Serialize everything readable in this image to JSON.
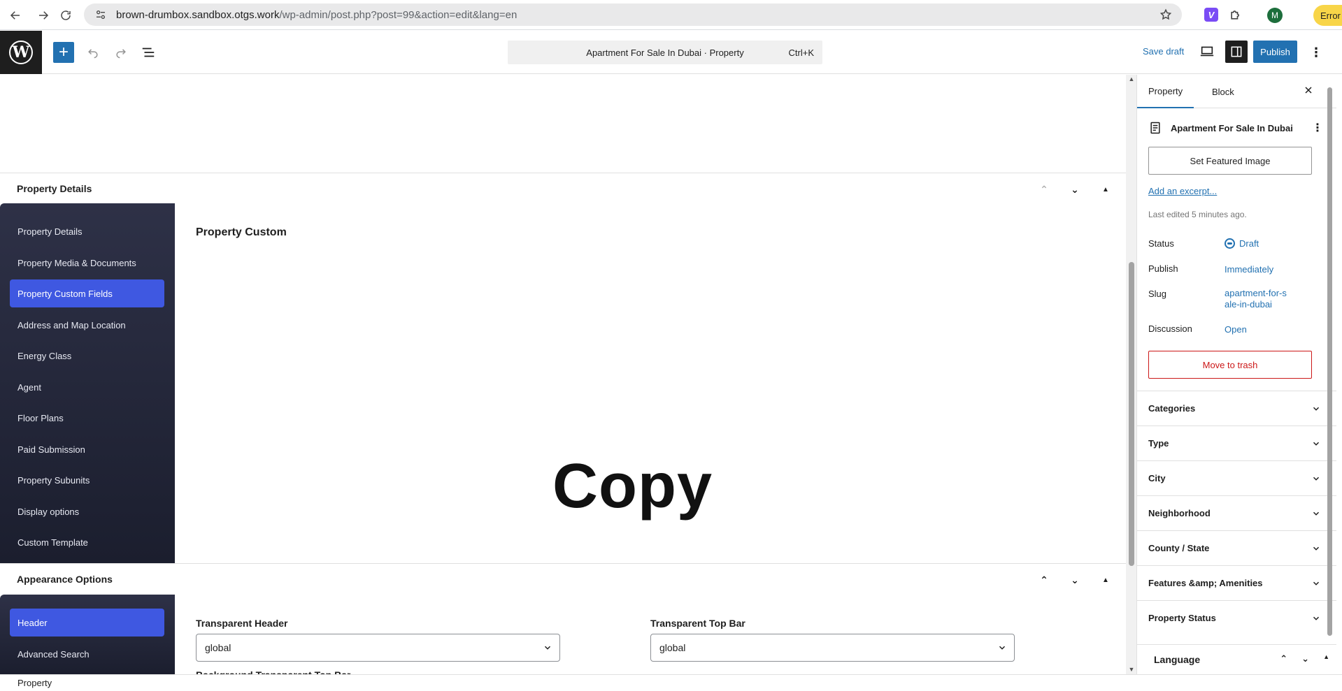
{
  "browser": {
    "url_host": "brown-drumbox.sandbox.otgs.work",
    "url_path": "/wp-admin/post.php?post=99&action=edit&lang=en",
    "profile_initial": "M",
    "error_label": "Error",
    "ext_v_label": "V"
  },
  "editor": {
    "wp_logo": "W",
    "doc_title": "Apartment For Sale In Dubai · Property",
    "shortcut": "Ctrl+K",
    "save_draft": "Save draft",
    "publish": "Publish"
  },
  "property_details": {
    "header": "Property Details",
    "nav_items": [
      "Property Details",
      "Property Media & Documents",
      "Property Custom Fields",
      "Address and Map Location",
      "Energy Class",
      "Agent",
      "Floor Plans",
      "Paid Submission",
      "Property Subunits",
      "Display options",
      "Custom Template"
    ],
    "active_index": 2,
    "content_title": "Property Custom",
    "overlay_text": "Copy"
  },
  "appearance": {
    "header": "Appearance Options",
    "nav_items": [
      "Header",
      "Advanced Search"
    ],
    "active_index": 0,
    "transparent_header_label": "Transparent Header",
    "transparent_header_value": "global",
    "transparent_topbar_label": "Transparent Top Bar",
    "transparent_topbar_value": "global",
    "cut_label": "Background Transparent Top Bar"
  },
  "sidebar": {
    "tabs": [
      "Property",
      "Block"
    ],
    "post_title": "Apartment For Sale In Dubai",
    "featured_image": "Set Featured Image",
    "excerpt": "Add an excerpt...",
    "last_edited": "Last edited 5 minutes ago.",
    "status_label": "Status",
    "status_value": "Draft",
    "publish_label": "Publish",
    "publish_value": "Immediately",
    "slug_label": "Slug",
    "slug_value": "apartment-for-sale-in-dubai",
    "discussion_label": "Discussion",
    "discussion_value": "Open",
    "trash": "Move to trash",
    "panels": [
      "Categories",
      "Type",
      "City",
      "Neighborhood",
      "County / State",
      "Features &amp; Amenities",
      "Property Status"
    ],
    "language": "Language"
  },
  "footer": {
    "breadcrumb": "Property"
  },
  "colors": {
    "accent": "#2271b1",
    "sidebar_active": "#3f58e1",
    "danger": "#cc1818"
  }
}
